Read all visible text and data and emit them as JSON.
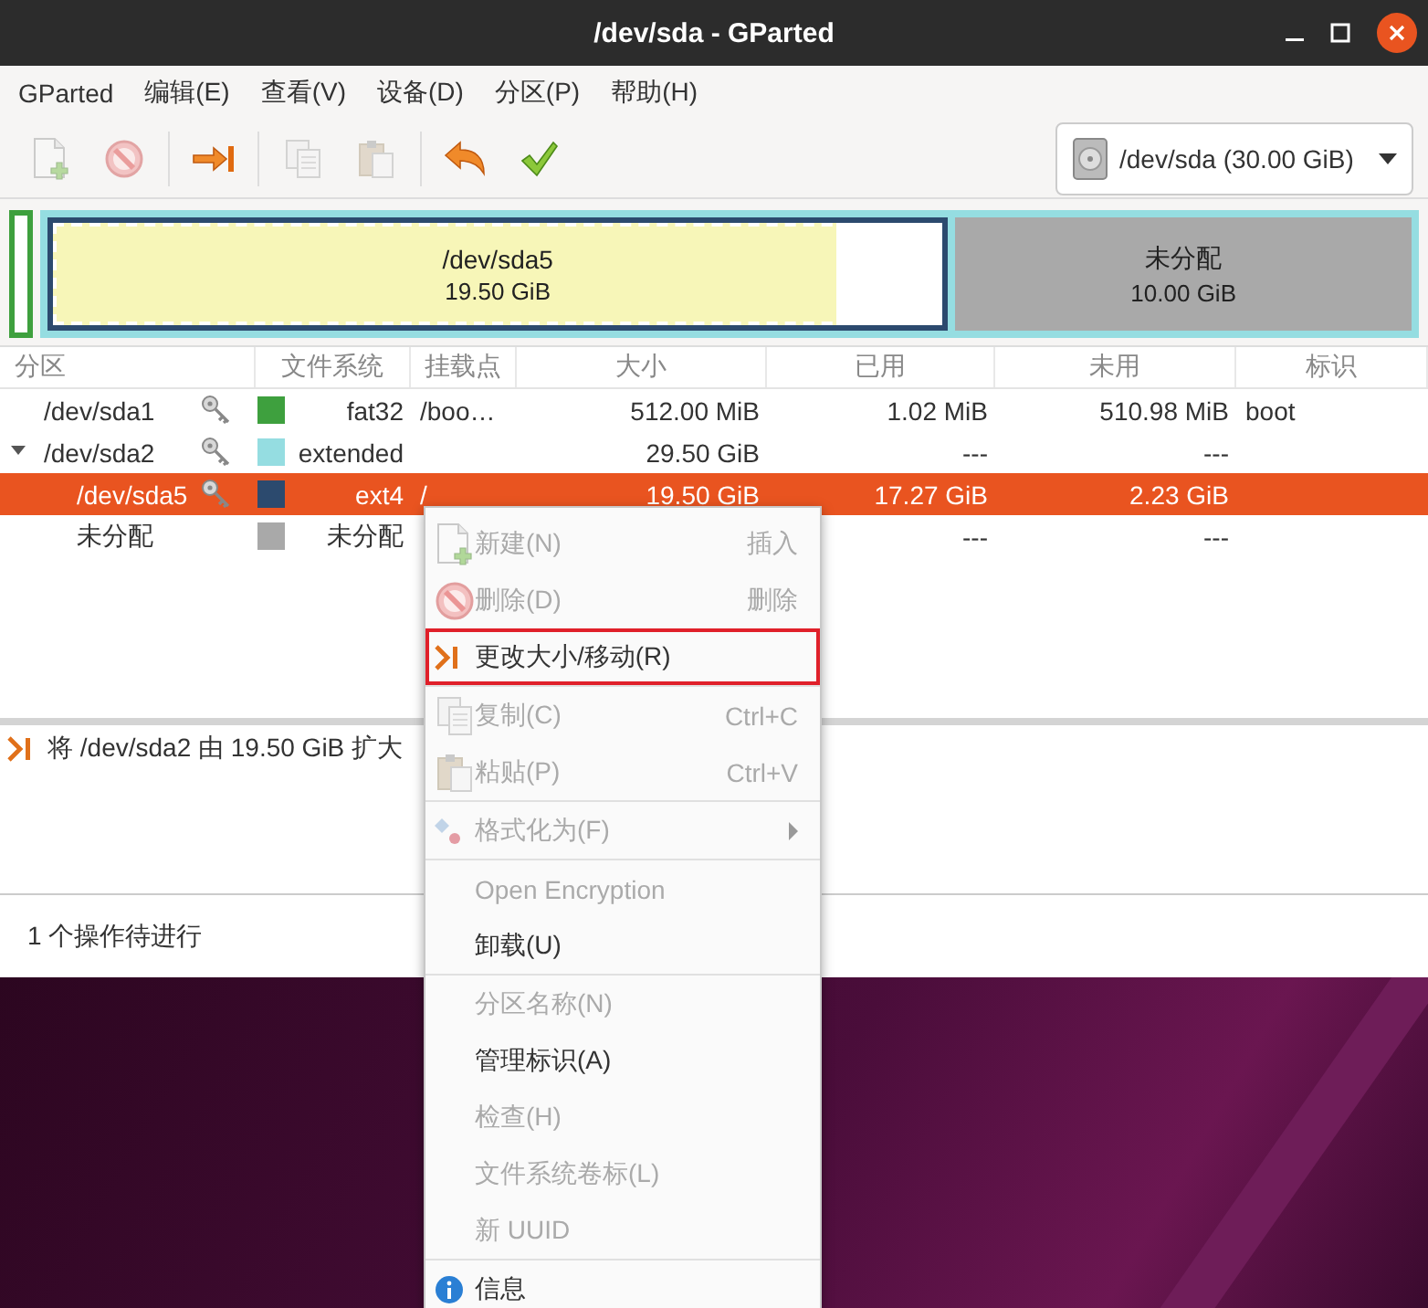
{
  "window": {
    "title": "/dev/sda - GParted"
  },
  "menubar": [
    "GParted",
    "编辑(E)",
    "查看(V)",
    "设备(D)",
    "分区(P)",
    "帮助(H)"
  ],
  "toolbar": [
    {
      "disabled": true
    },
    {
      "disabled": true
    },
    {
      "disabled": false
    },
    {
      "disabled": true
    },
    {
      "disabled": true
    },
    {
      "disabled": false
    },
    {
      "disabled": false
    }
  ],
  "device": {
    "label": "/dev/sda (30.00 GiB)"
  },
  "disk_map": {
    "segments": [
      {
        "kind": "primary",
        "color": "#3ea03e"
      },
      {
        "kind": "extended",
        "color": "#95dde1",
        "children": [
          {
            "kind": "logical",
            "name": "/dev/sda5",
            "size": "19.50 GiB",
            "color": "#2c4a6e",
            "selected": true,
            "level": 0.88
          },
          {
            "kind": "unallocated",
            "name": "未分配",
            "size": "10.00 GiB",
            "color": "#a9a9a9",
            "selected": false
          }
        ]
      }
    ]
  },
  "table": {
    "columns": [
      "分区",
      "文件系统",
      "挂载点",
      "大小",
      "已用",
      "未用",
      "标识"
    ],
    "rows": [
      {
        "partition": "/dev/sda1",
        "locked": true,
        "color": "#3ea03e",
        "filesystem": "fat32",
        "mountpoint": "/boo…",
        "size": "512.00 MiB",
        "used": "1.02 MiB",
        "unused": "510.98 MiB",
        "flags": "boot",
        "selected": false
      },
      {
        "partition": "/dev/sda2",
        "locked": true,
        "color": "#95dde1",
        "filesystem": "extended",
        "size": "29.50 GiB",
        "used": "---",
        "unused": "---",
        "selected": false,
        "expanded": true,
        "children": [
          {
            "partition": "/dev/sda5",
            "locked": true,
            "color": "#2c4a6e",
            "filesystem": "ext4",
            "mountpoint": "/",
            "size": "19.50 GiB",
            "used": "17.27 GiB",
            "unused": "2.23 GiB",
            "selected": true
          },
          {
            "partition": "未分配",
            "locked": false,
            "color": "#a9a9a9",
            "filesystem": "未分配",
            "used": "---",
            "unused": "---",
            "selected": false
          }
        ]
      }
    ]
  },
  "operations": [
    {
      "text": "将 /dev/sda2 由 19.50 GiB 扩大"
    }
  ],
  "status_bar": {
    "text": "1 个操作待进行"
  },
  "context_menu": {
    "items": [
      {
        "kind": "item",
        "label": "新建(N)",
        "shortcut": "插入",
        "disabled": true
      },
      {
        "kind": "item",
        "label": "删除(D)",
        "shortcut": "删除",
        "disabled": true
      },
      {
        "kind": "item",
        "label": "更改大小/移动(R)",
        "disabled": false,
        "outlined": true
      },
      {
        "kind": "separator"
      },
      {
        "kind": "item",
        "label": "复制(C)",
        "shortcut": "Ctrl+C",
        "disabled": true
      },
      {
        "kind": "item",
        "label": "粘贴(P)",
        "shortcut": "Ctrl+V",
        "disabled": true
      },
      {
        "kind": "separator"
      },
      {
        "kind": "item",
        "label": "格式化为(F)",
        "disabled": true,
        "submenu": true
      },
      {
        "kind": "separator"
      },
      {
        "kind": "item",
        "label": "Open Encryption",
        "disabled": true
      },
      {
        "kind": "item",
        "label": "卸载(U)",
        "disabled": false
      },
      {
        "kind": "separator"
      },
      {
        "kind": "item",
        "label": "分区名称(N)",
        "disabled": true
      },
      {
        "kind": "item",
        "label": "管理标识(A)",
        "disabled": false
      },
      {
        "kind": "item",
        "label": "检查(H)",
        "disabled": true
      },
      {
        "kind": "item",
        "label": "文件系统卷标(L)",
        "disabled": true
      },
      {
        "kind": "item",
        "label": "新 UUID",
        "disabled": true
      },
      {
        "kind": "separator"
      },
      {
        "kind": "item",
        "label": "信息",
        "disabled": false
      }
    ]
  }
}
